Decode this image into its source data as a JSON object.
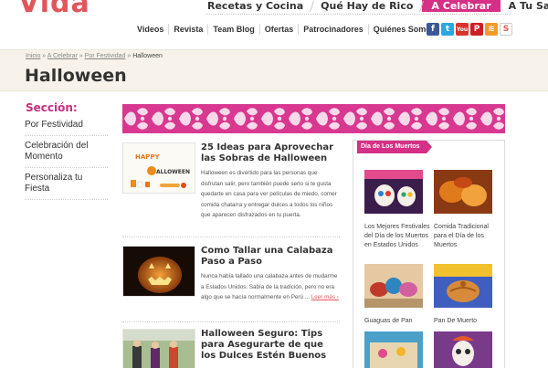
{
  "brand": {
    "logo": "Vida"
  },
  "top_nav": [
    {
      "label": "Recetas y Cocina",
      "active": false
    },
    {
      "label": "Qué Hay de Rico",
      "active": false
    },
    {
      "label": "A Celebrar",
      "active": true
    },
    {
      "label": "A Tu Salud",
      "active": false
    }
  ],
  "sub_nav": [
    "Videos",
    "Revista",
    "Team Blog",
    "Ofertas",
    "Patrocinadores",
    "Quiénes Somos"
  ],
  "social": [
    {
      "name": "facebook-icon",
      "glyph": "f"
    },
    {
      "name": "twitter-icon",
      "glyph": "t"
    },
    {
      "name": "youtube-icon",
      "glyph": "You"
    },
    {
      "name": "pinterest-icon",
      "glyph": "P"
    },
    {
      "name": "rss-icon",
      "glyph": "≋"
    },
    {
      "name": "stumbleupon-icon",
      "glyph": "S"
    }
  ],
  "breadcrumb": {
    "home": "Inicio",
    "sep": "»",
    "level1": "A Celebrar",
    "level2": "Por Festividad",
    "current": "Halloween"
  },
  "page_title": "Halloween",
  "sidebar": {
    "heading": "Sección:",
    "items": [
      "Por Festividad",
      "Celebración del Momento",
      "Personaliza tu Fiesta"
    ]
  },
  "articles": [
    {
      "title": "25 Ideas para Aprovechar las Sobras de Halloween",
      "body": "Halloween es divertido para las personas que disfrutan salir, pero también puede serlo si te gusta quedarte en casa para ver películas de miedo, comer comida chatarra y entregar dulces a todos los niños que aparecen disfrazados en tu puerta.",
      "more": ""
    },
    {
      "title": "Como Tallar una Calabaza Paso a Paso",
      "body": "Nunca había tallado una calabaza antes de mudarme a Estados Unidos. Sabía de la tradición, pero no era algo que se hacía normalmente en Perú ...",
      "more": "Leer más ›"
    },
    {
      "title": "Halloween Seguro: Tips para Asegurarte de que los Dulces Estén Buenos",
      "body": "",
      "more": ""
    }
  ],
  "thumb_text": {
    "happy": "HAPPY",
    "halloween": "ALLOWEEN"
  },
  "widget": {
    "tab": "Día de Los Muertos",
    "items": [
      {
        "caption": "Los Mejores Festivales del Día de los Muertos en Estados Unidos"
      },
      {
        "caption": "Comida Tradicional para el Día de los Muertos"
      },
      {
        "caption": "Guaguas de Pan"
      },
      {
        "caption": "Pan De Muerto"
      },
      {
        "caption": ""
      },
      {
        "caption": ""
      }
    ]
  },
  "colors": {
    "accent": "#d62f86",
    "logo": "#e0565a",
    "band": "#f7f3ea",
    "link": "#e0585d"
  }
}
